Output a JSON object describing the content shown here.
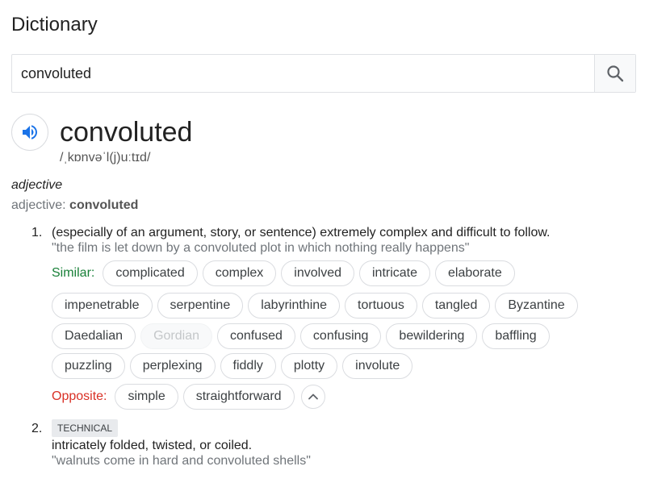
{
  "header": {
    "title": "Dictionary"
  },
  "search": {
    "value": "convoluted",
    "icon": "search-icon"
  },
  "entry": {
    "word": "convoluted",
    "phonetic": "/ˌkɒnvəˈl(j)uːtɪd/",
    "part_of_speech": "adjective",
    "forms_label": "adjective:",
    "forms_value": "convoluted"
  },
  "senses": [
    {
      "number": "1.",
      "definition": "(especially of an argument, story, or sentence) extremely complex and difficult to follow.",
      "example": "\"the film is let down by a convoluted plot in which nothing really happens\"",
      "similar_label": "Similar:",
      "similar": [
        "complicated",
        "complex",
        "involved",
        "intricate",
        "elaborate",
        "impenetrable",
        "serpentine",
        "labyrinthine",
        "tortuous",
        "tangled",
        "Byzantine",
        "Daedalian",
        "Gordian",
        "confused",
        "confusing",
        "bewildering",
        "baffling",
        "puzzling",
        "perplexing",
        "fiddly",
        "plotty",
        "involute"
      ],
      "opposite_label": "Opposite:",
      "opposite": [
        "simple",
        "straightforward"
      ]
    },
    {
      "number": "2.",
      "tag": "TECHNICAL",
      "definition": "intricately folded, twisted, or coiled.",
      "example": "\"walnuts come in hard and convoluted shells\""
    }
  ],
  "colors": {
    "similar_label": "#188038",
    "opposite_label": "#d93025",
    "speaker_icon": "#1a73e8"
  }
}
